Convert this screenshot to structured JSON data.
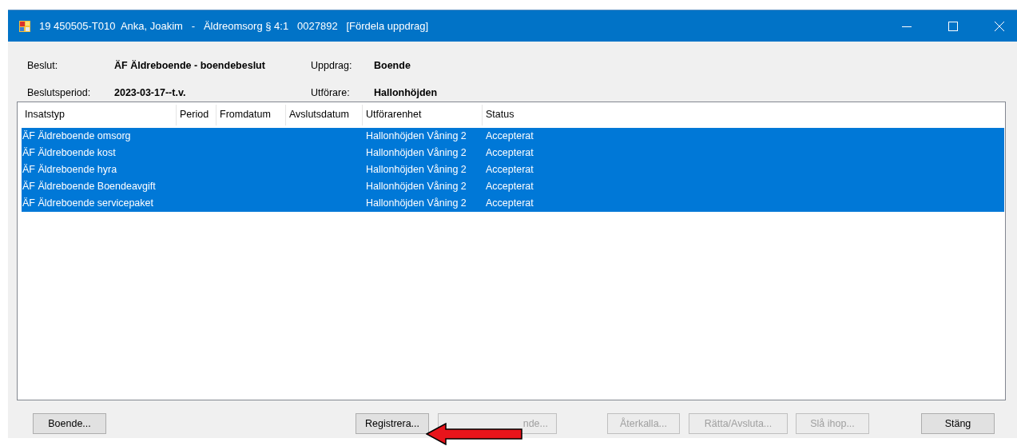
{
  "window": {
    "title": "19 450505-T010  Anka, Joakim   -   Äldreomsorg § 4:1   0027892   [Fördela uppdrag]"
  },
  "info": [
    {
      "label": "Beslut:",
      "value": "ÄF Äldreboende - boendebeslut"
    },
    {
      "label": "Uppdrag:",
      "value": "Boende"
    },
    {
      "label": "Beslutsperiod:",
      "value": "2023-03-17--t.v."
    },
    {
      "label": "Utförare:",
      "value": "Hallonhöjden"
    }
  ],
  "table": {
    "columns": [
      "Insatstyp",
      "Period",
      "Fromdatum",
      "Avslutsdatum",
      "Utförarenhet",
      "Status"
    ],
    "rows": [
      {
        "cells": [
          "ÄF Äldreboende omsorg",
          "",
          "",
          "",
          "Hallonhöjden Våning 2",
          "Accepterat"
        ],
        "selected": true
      },
      {
        "cells": [
          "ÄF Äldreboende kost",
          "",
          "",
          "",
          "Hallonhöjden Våning 2",
          "Accepterat"
        ],
        "selected": true
      },
      {
        "cells": [
          "ÄF Äldreboende hyra",
          "",
          "",
          "",
          "Hallonhöjden Våning 2",
          "Accepterat"
        ],
        "selected": true
      },
      {
        "cells": [
          "ÄF Äldreboende Boendeavgift",
          "",
          "",
          "",
          "Hallonhöjden Våning 2",
          "Accepterat"
        ],
        "selected": true
      },
      {
        "cells": [
          "ÄF Äldreboende servicepaket",
          "",
          "",
          "",
          "Hallonhöjden Våning 2",
          "Accepterat"
        ],
        "selected": true
      }
    ]
  },
  "buttons": [
    {
      "label": "Boende...",
      "disabled": false
    },
    {
      "label": "Registrera...",
      "disabled": false
    },
    {
      "label": "nde...",
      "disabled": true
    },
    {
      "label": "Återkalla...",
      "disabled": true
    },
    {
      "label": "Rätta/Avsluta...",
      "disabled": true
    },
    {
      "label": "Slå ihop...",
      "disabled": true
    },
    {
      "label": "Stäng",
      "disabled": false
    }
  ]
}
